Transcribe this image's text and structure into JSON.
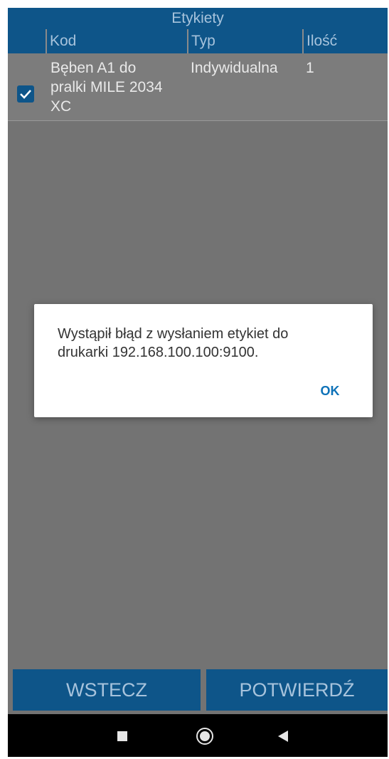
{
  "screen": {
    "title": "Etykiety"
  },
  "table": {
    "columns": [
      "Kod",
      "Typ",
      "Ilość"
    ],
    "rows": [
      {
        "checked": true,
        "kod_lines": [
          "Bęben A1 do",
          "pralki MILE 2034",
          "XC"
        ],
        "typ": "Indywidualna",
        "ilosc": "1"
      }
    ]
  },
  "buttons": {
    "back": "WSTECZ",
    "confirm": "POTWIERDŹ"
  },
  "dialog": {
    "message_lines": [
      "Wystąpił błąd z wysłaniem etykiet do",
      "drukarki 192.168.100.100:9100."
    ],
    "ok": "OK"
  },
  "colors": {
    "brand_blue": "#0e5589",
    "dialog_accent": "#0e72b8"
  },
  "icons": {
    "checkbox": "check-icon",
    "nav": [
      "square-stop-icon",
      "circle-home-icon",
      "triangle-back-icon"
    ]
  }
}
